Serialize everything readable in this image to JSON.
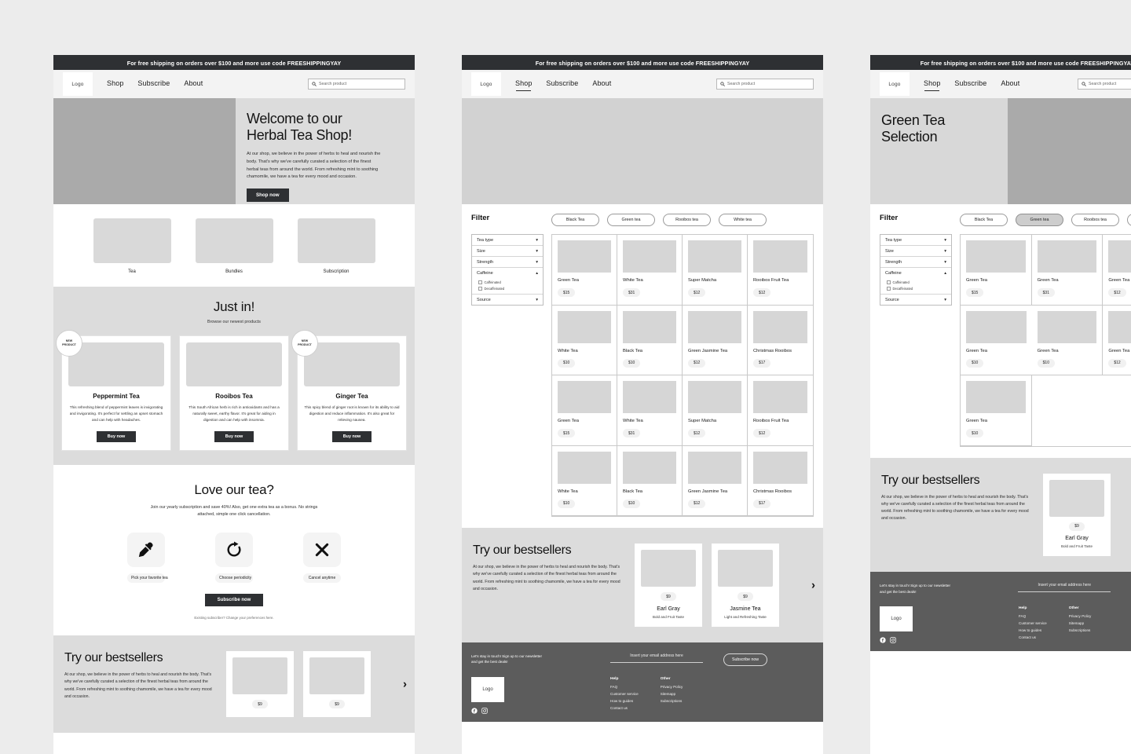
{
  "announcement": "For free shipping on orders over $100 and more use code FREESHIPPINGYAY",
  "nav": {
    "logo": "Logo",
    "links": [
      "Shop",
      "Subscribe",
      "About"
    ],
    "search_placeholder": "Search product"
  },
  "home": {
    "hero": {
      "title_line1": "Welcome to our",
      "title_line2": "Herbal Tea Shop!",
      "body": "At our shop, we believe in the power of herbs to heal and nourish the body. That's why we've carefully curated a selection of the finest herbal teas from around the world. From refreshing mint to soothing chamomile, we have a tea for every mood and occasion.",
      "cta": "Shop now"
    },
    "categories": [
      "Tea",
      "Bundles",
      "Subscription"
    ],
    "justin": {
      "title": "Just in!",
      "subtitle": "Browse our newest products",
      "badge_line1": "NEW",
      "badge_line2": "PRODUCT",
      "buy_label": "Buy now",
      "products": [
        {
          "name": "Peppermint Tea",
          "desc": "This refreshing blend of peppermint leaves is invigorating and invigorating. It's perfect for settling an upset stomach and can help with headaches.",
          "is_new": true
        },
        {
          "name": "Rooibos Tea",
          "desc": "This South African herb is rich in antioxidants and has a naturally sweet, earthy flavor. It's great for aiding in digestion and can help with insomnia.",
          "is_new": false
        },
        {
          "name": "Ginger Tea",
          "desc": "This spicy blend of ginger root is known for its ability to aid digestion and reduce inflammation. It's also great for relieving nausea.",
          "is_new": true
        }
      ]
    },
    "love": {
      "title": "Love our tea?",
      "lead": "Join our yearly subscription and save 40%! Also, get one extra tea as a bonus. No strings attached, simple one click cancellation.",
      "perks": [
        {
          "icon": "eyedropper-icon",
          "label": "Pick your favorite tea"
        },
        {
          "icon": "refresh-icon",
          "label": "Choose periodicity"
        },
        {
          "icon": "close-x-icon",
          "label": "Cancel anytime"
        }
      ],
      "cta": "Subscribe now",
      "fine_print": "Existing subscriber? Change your preferences here."
    }
  },
  "bestsellers": {
    "title": "Try our bestsellers",
    "body": "At our shop, we believe in the power of herbs to heal and nourish the body. That's why we've carefully curated a selection of the finest herbal teas from around the world. From refreshing mint to soothing chamomile, we have a tea for every mood and occasion.",
    "cards": [
      {
        "price": "$9",
        "name": "Earl Gray",
        "tag": "Bold and Fruit Taste"
      },
      {
        "price": "$9",
        "name": "Jasmine Tea",
        "tag": "Light and Refreshing Taste"
      }
    ]
  },
  "filter": {
    "title": "Filter",
    "chips": [
      "Black Tea",
      "Green tea",
      "Rooibos tea",
      "White tea"
    ],
    "selected_chip": "Green tea",
    "groups": [
      {
        "label": "Tea type",
        "state": "collapsed"
      },
      {
        "label": "Size",
        "state": "collapsed"
      },
      {
        "label": "Strength",
        "state": "collapsed"
      },
      {
        "label": "Caffeine",
        "state": "expanded",
        "options": [
          "Caffeinated",
          "Decaffeinated"
        ]
      },
      {
        "label": "Source",
        "state": "collapsed"
      }
    ]
  },
  "shop_products": [
    {
      "name": "Green Tea",
      "price": "$15"
    },
    {
      "name": "White Tea",
      "price": "$31"
    },
    {
      "name": "Super Matcha",
      "price": "$12"
    },
    {
      "name": "Rooibos Fruit Tea",
      "price": "$12"
    },
    {
      "name": "White Tea",
      "price": "$10"
    },
    {
      "name": "Black Tea",
      "price": "$10"
    },
    {
      "name": "Green Jasmine Tea",
      "price": "$12"
    },
    {
      "name": "Christmas Rooibos",
      "price": "$17"
    },
    {
      "name": "Green Tea",
      "price": "$15"
    },
    {
      "name": "White Tea",
      "price": "$31"
    },
    {
      "name": "Super Matcha",
      "price": "$12"
    },
    {
      "name": "Rooibos Fruit Tea",
      "price": "$12"
    },
    {
      "name": "White Tea",
      "price": "$10"
    },
    {
      "name": "Black Tea",
      "price": "$10"
    },
    {
      "name": "Green Jasmine Tea",
      "price": "$12"
    },
    {
      "name": "Christmas Rooibos",
      "price": "$17"
    }
  ],
  "green_page": {
    "hero_title_line1": "Green Tea",
    "hero_title_line2": "Selection",
    "products": [
      {
        "name": "Green Tea",
        "price": "$15"
      },
      {
        "name": "Green Tea",
        "price": "$31"
      },
      {
        "name": "Green Tea",
        "price": "$12"
      },
      {
        "name": "Green Tea",
        "price": "$10"
      },
      {
        "name": "Green Tea",
        "price": "$10"
      },
      {
        "name": "Green Tea",
        "price": "$12"
      },
      {
        "name": "Green Tea",
        "price": "$10"
      }
    ]
  },
  "footer": {
    "newsletter_line1": "Let's stay in touch! Sign up to our newsletter",
    "newsletter_line2": "and get the best deals!",
    "email_placeholder": "Insert your email address here",
    "subscribe_label": "Subscribe now",
    "logo": "Logo",
    "columns": [
      {
        "heading": "Help",
        "links": [
          "FAQ",
          "Customer service",
          "How to guides",
          "Contact us"
        ]
      },
      {
        "heading": "Other",
        "links": [
          "Privacy Policy",
          "Sitemapp",
          "Subscriptions"
        ]
      }
    ],
    "socials": [
      "facebook-icon",
      "instagram-icon"
    ]
  },
  "colors": {
    "dark": "#2e3033",
    "footer": "#5c5c5c",
    "placeholder_gray": "#d9d9d9",
    "page_bg": "#ececec"
  }
}
